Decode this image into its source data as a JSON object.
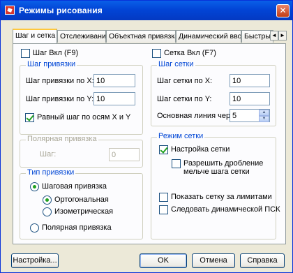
{
  "window": {
    "title": "Режимы рисования",
    "close_glyph": "✕"
  },
  "tabs": [
    {
      "label": "Шаг и сетка",
      "active": true
    },
    {
      "label": "Отслеживание"
    },
    {
      "label": "Объектная привязка"
    },
    {
      "label": "Динамический ввод"
    },
    {
      "label": "Быстры"
    }
  ],
  "tab_scroll": {
    "left": "◄",
    "right": "►"
  },
  "snap": {
    "toggle_label": "Шаг Вкл (F9)",
    "toggle_checked": false,
    "group_title": "Шаг привязки",
    "x_label": "Шаг привязки по X:",
    "x_value": "10",
    "y_label": "Шаг привязки по Y:",
    "y_value": "10",
    "equal_label": "Равный шаг по осям X и Y",
    "equal_checked": true
  },
  "polar": {
    "group_title": "Полярная привязка",
    "step_label": "Шаг:",
    "step_value": "0"
  },
  "snap_type": {
    "group_title": "Тип привязки",
    "grid_snap_label": "Шаговая привязка",
    "rect_label": "Ортогональная",
    "iso_label": "Изометрическая",
    "polar_label": "Полярная привязка"
  },
  "grid": {
    "toggle_label": "Сетка Вкл (F7)",
    "toggle_checked": false,
    "group_title": "Шаг сетки",
    "x_label": "Шаг сетки по X:",
    "x_value": "10",
    "y_label": "Шаг сетки по Y:",
    "y_value": "10",
    "major_label": "Основная линия через:",
    "major_value": "5"
  },
  "grid_mode": {
    "group_title": "Режим сетки",
    "adaptive_label": "Настройка сетки",
    "adaptive_checked": true,
    "subdivision_label_1": "Разрешить дробление",
    "subdivision_label_2": "мельче шага сетки",
    "subdivision_checked": false,
    "beyond_limits_label": "Показать сетку за лимитами",
    "beyond_limits_checked": false,
    "follow_ucs_label": "Следовать динамической ПСК",
    "follow_ucs_checked": false
  },
  "buttons": {
    "options": "Настройка...",
    "ok": "OK",
    "cancel": "Отмена",
    "help": "Справка"
  }
}
